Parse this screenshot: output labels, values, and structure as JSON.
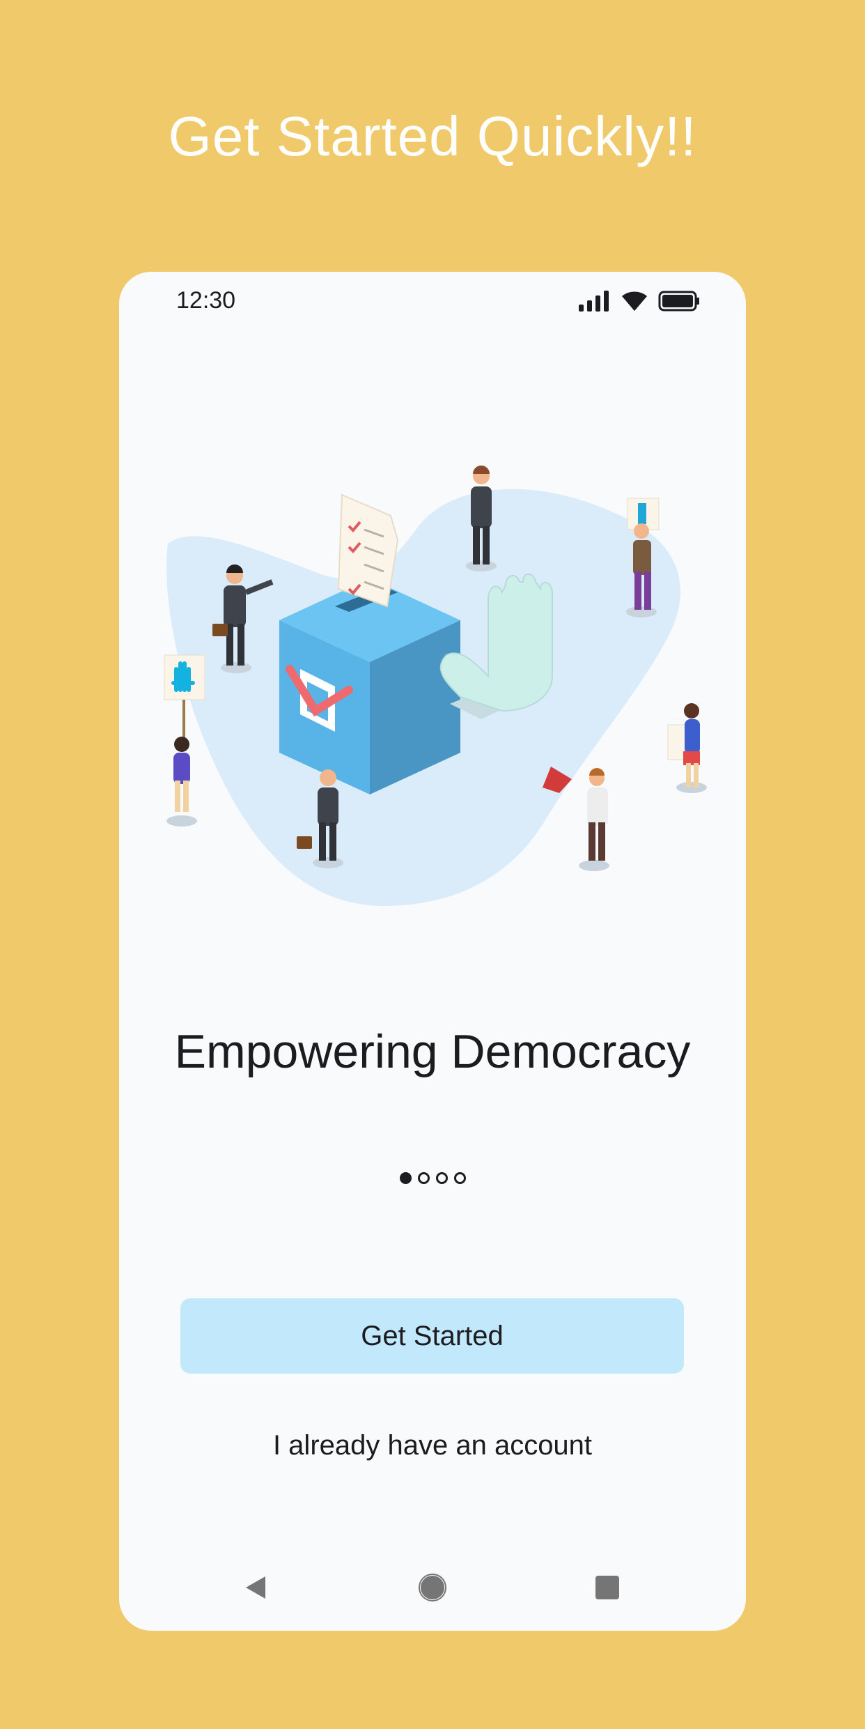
{
  "page": {
    "headline": "Get Started Quickly!!",
    "background_color": "#F0C96A"
  },
  "status_bar": {
    "time": "12:30",
    "icons": [
      "signal-icon",
      "wifi-icon",
      "battery-icon"
    ]
  },
  "onboarding": {
    "illustration": "voting-democracy-illustration",
    "title": "Empowering Democracy",
    "pager": {
      "total": 4,
      "active": 1
    },
    "primary_button_label": "Get Started",
    "secondary_link_label": "I already have an account",
    "primary_button_color": "#C2E8FC"
  },
  "nav_bar": {
    "icons": [
      "back-icon",
      "home-icon",
      "recents-icon"
    ]
  }
}
